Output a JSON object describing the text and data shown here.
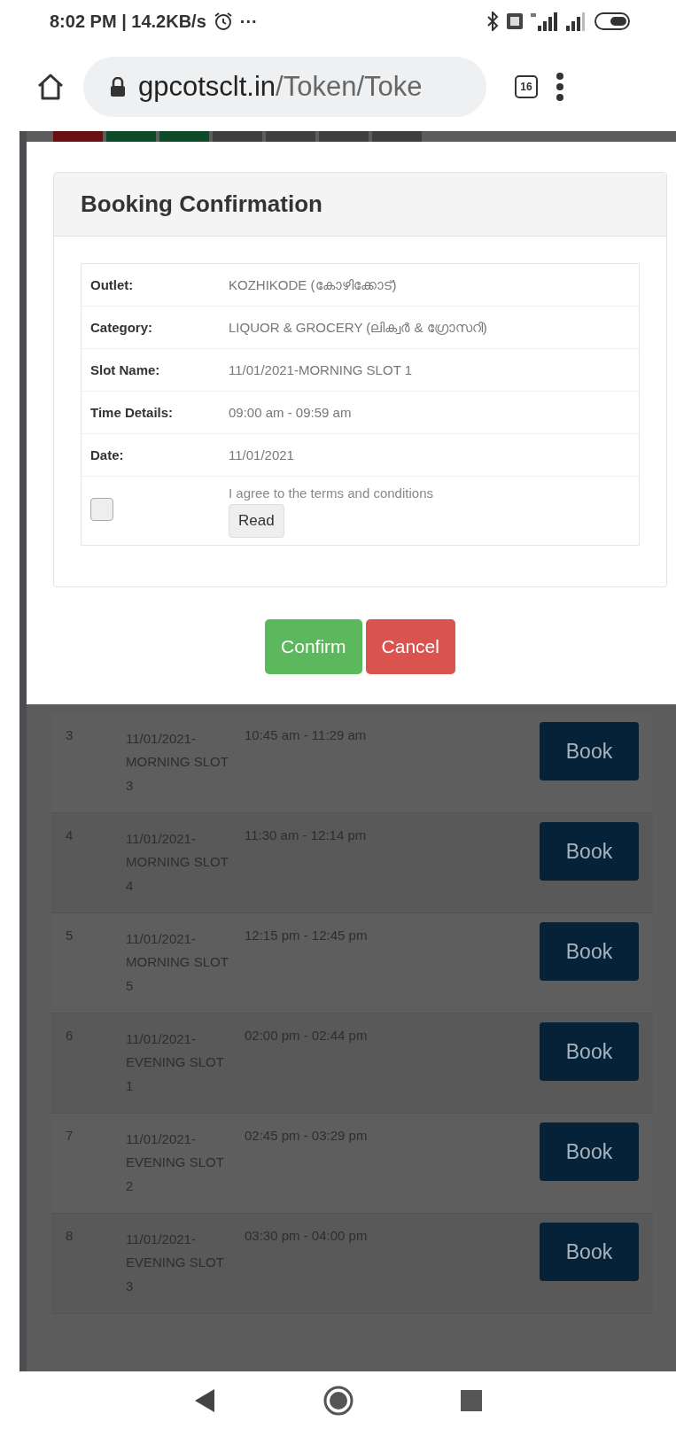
{
  "status_bar": {
    "time": "8:02 PM | 14.2KB/s",
    "more": "···"
  },
  "browser": {
    "url_host": "gpcotsclt.in",
    "url_path": "/Token/Toke",
    "tab_count": "16"
  },
  "page_tabs": [
    {
      "color": "#6a0f14"
    },
    {
      "color": "#0e4a2a"
    },
    {
      "color": "#0e4a2a"
    },
    {
      "color": "#3f3f3f"
    },
    {
      "color": "#3f3f3f"
    },
    {
      "color": "#3f3f3f"
    },
    {
      "color": "#3f3f3f"
    }
  ],
  "modal": {
    "title": "Booking Confirmation",
    "details": [
      {
        "label": "Outlet:",
        "value": "KOZHIKODE (കോഴിക്കോട്)"
      },
      {
        "label": "Category:",
        "value": "LIQUOR & GROCERY (ലിക്വർ & ഗ്രോസറി)"
      },
      {
        "label": "Slot Name:",
        "value": "11/01/2021-MORNING SLOT 1"
      },
      {
        "label": "Time Details:",
        "value": "09:00 am - 09:59 am"
      },
      {
        "label": "Date:",
        "value": "11/01/2021"
      }
    ],
    "agree": {
      "checked": false,
      "text": "I agree to the terms and conditions",
      "read_button": "Read"
    },
    "buttons": [
      {
        "kind": "confirm",
        "label": "Confirm"
      },
      {
        "kind": "cancel",
        "label": "Cancel"
      }
    ]
  },
  "slots": [
    {
      "number": "3",
      "name": "11/01/2021-MORNING SLOT 3",
      "time": "10:45 am - 11:29 am",
      "button": "Book"
    },
    {
      "number": "4",
      "name": "11/01/2021-MORNING SLOT 4",
      "time": "11:30 am - 12:14 pm",
      "button": "Book"
    },
    {
      "number": "5",
      "name": "11/01/2021-MORNING SLOT 5",
      "time": "12:15 pm - 12:45 pm",
      "button": "Book"
    },
    {
      "number": "6",
      "name": "11/01/2021-EVENING SLOT 1",
      "time": "02:00 pm - 02:44 pm",
      "button": "Book"
    },
    {
      "number": "7",
      "name": "11/01/2021-EVENING SLOT 2",
      "time": "02:45 pm - 03:29 pm",
      "button": "Book"
    },
    {
      "number": "8",
      "name": "11/01/2021-EVENING SLOT 3",
      "time": "03:30 pm - 04:00 pm",
      "button": "Book"
    }
  ]
}
